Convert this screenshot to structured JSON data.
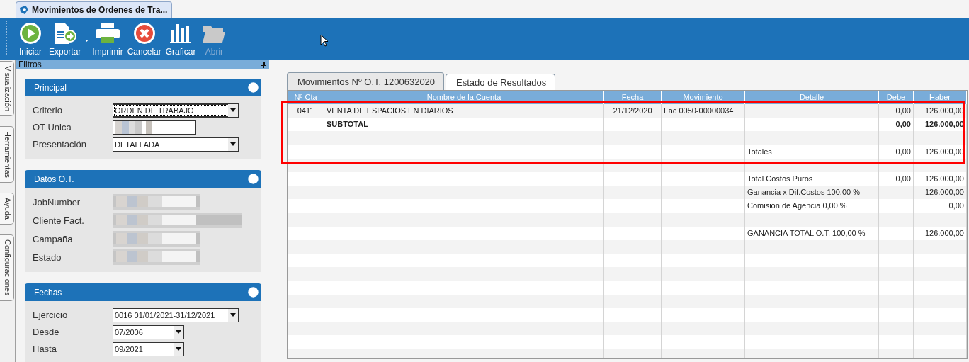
{
  "window": {
    "title": "Movimientos de Ordenes de Tra..."
  },
  "toolbar": [
    {
      "label": "Iniciar",
      "kind": "play",
      "disabled": false
    },
    {
      "label": "Exportar",
      "kind": "export",
      "disabled": false
    },
    {
      "label": "Imprimir",
      "kind": "print",
      "disabled": false
    },
    {
      "label": "Cancelar",
      "kind": "cancel",
      "disabled": false
    },
    {
      "label": "Graficar",
      "kind": "chart",
      "disabled": false
    },
    {
      "label": "Abrir",
      "kind": "folder",
      "disabled": true
    }
  ],
  "side_tabs": [
    {
      "label": "Visualización",
      "selected": false
    },
    {
      "label": "Herramientas",
      "selected": false
    },
    {
      "label": "Ayuda",
      "selected": false
    },
    {
      "label": "Configuraciones",
      "selected": false
    }
  ],
  "filters": {
    "title": "Filtros",
    "groups": [
      {
        "title": "Principal",
        "fields": [
          {
            "label": "Criterio",
            "kind": "select",
            "value": "ORDEN DE TRABAJO",
            "focused": true
          },
          {
            "label": "OT Unica",
            "kind": "blurred"
          },
          {
            "label": "Presentación",
            "kind": "select",
            "value": "DETALLADA",
            "focused": false
          }
        ]
      },
      {
        "title": "Datos O.T.",
        "fields": [
          {
            "label": "JobNumber",
            "kind": "blurred"
          },
          {
            "label": "Cliente Fact.",
            "kind": "blurred-wide"
          },
          {
            "label": "Campaña",
            "kind": "blurred"
          },
          {
            "label": "Estado",
            "kind": "blurred"
          }
        ]
      },
      {
        "title": "Fechas",
        "fields": [
          {
            "label": "Ejercicio",
            "kind": "select",
            "value": "0016 01/01/2021-31/12/2021",
            "focused": false
          },
          {
            "label": "Desde",
            "kind": "select-short",
            "value": "07/2006",
            "focused": false
          },
          {
            "label": "Hasta",
            "kind": "select-short",
            "value": "09/2021",
            "focused": false
          }
        ]
      }
    ]
  },
  "report": {
    "tabs": [
      {
        "label": "Movimientos Nº O.T. 1200632020",
        "selected": true
      },
      {
        "label": "Estado de Resultados",
        "selected": false
      }
    ],
    "table": {
      "columns": [
        "Nº Cta",
        "Nombre de la Cuenta",
        "Fecha",
        "Movimiento",
        "Detalle",
        "Debe",
        "Haber"
      ],
      "rows": [
        {
          "bold": false,
          "cells": [
            "0411",
            "VENTA DE ESPACIOS EN DIARIOS",
            "21/12/2020",
            "Fac 0050-00000034",
            "",
            "0,00",
            "126.000,00"
          ]
        },
        {
          "bold": true,
          "cells": [
            "",
            "SUBTOTAL",
            "",
            "",
            "",
            "0,00",
            "126.000,00"
          ]
        },
        {
          "cells": [
            "",
            "",
            "",
            "",
            "",
            "",
            ""
          ]
        },
        {
          "bold": false,
          "cells": [
            "",
            "",
            "",
            "",
            "Totales",
            "0,00",
            "126.000,00"
          ]
        },
        {
          "cells": [
            "",
            "",
            "",
            "",
            "",
            "",
            ""
          ]
        },
        {
          "bold": false,
          "cells": [
            "",
            "",
            "",
            "",
            "Total Costos Puros",
            "0,00",
            "126.000,00"
          ]
        },
        {
          "bold": false,
          "cells": [
            "",
            "",
            "",
            "",
            "Ganancia x Dif.Costos 100,00 %",
            "",
            "126.000,00"
          ]
        },
        {
          "bold": false,
          "cells": [
            "",
            "",
            "",
            "",
            "Comisión de Agencia 0,00 %",
            "",
            "0,00"
          ]
        },
        {
          "cells": [
            "",
            "",
            "",
            "",
            "",
            "",
            ""
          ]
        },
        {
          "bold": false,
          "cells": [
            "",
            "",
            "",
            "",
            "GANANCIA TOTAL O.T. 100,00 %",
            "",
            "126.000,00"
          ]
        }
      ]
    }
  }
}
